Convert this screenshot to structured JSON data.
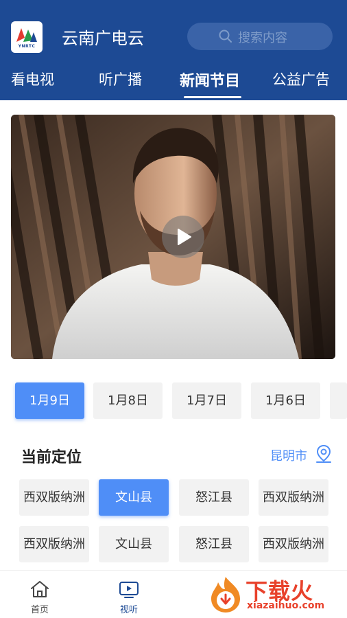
{
  "header": {
    "logo_text": "YNRTC",
    "app_title": "云南广电云",
    "search_placeholder": "搜索内容"
  },
  "tabs": [
    {
      "label": "看电视"
    },
    {
      "label": "听广播"
    },
    {
      "label": "新闻节目",
      "active": true
    },
    {
      "label": "公益广告"
    }
  ],
  "dates": [
    {
      "label": "1月9日",
      "active": true
    },
    {
      "label": "1月8日"
    },
    {
      "label": "1月7日"
    },
    {
      "label": "1月6日"
    }
  ],
  "location": {
    "title": "当前定位",
    "city": "昆明市"
  },
  "regions": [
    {
      "label": "西双版纳洲"
    },
    {
      "label": "文山县",
      "active": true
    },
    {
      "label": "怒江县"
    },
    {
      "label": "西双版纳洲"
    },
    {
      "label": "西双版纳洲"
    },
    {
      "label": "文山县"
    },
    {
      "label": "怒江县"
    },
    {
      "label": "西双版纳洲"
    }
  ],
  "bottom_nav": [
    {
      "label": "首页",
      "icon": "home-icon"
    },
    {
      "label": "视听",
      "icon": "tv-icon",
      "active": true
    }
  ],
  "watermark": {
    "text": "下载火",
    "sub": "xiazaihuo.com"
  },
  "colors": {
    "header_bg": "#1d4a94",
    "accent": "#4f8ef7",
    "watermark": "#e8412b"
  }
}
